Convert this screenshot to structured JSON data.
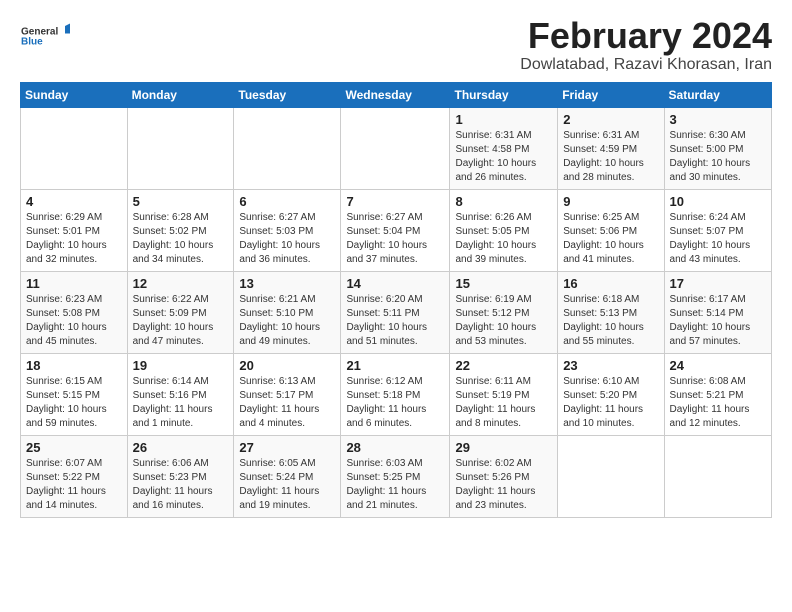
{
  "logo": {
    "general": "General",
    "blue": "Blue"
  },
  "title": "February 2024",
  "subtitle": "Dowlatabad, Razavi Khorasan, Iran",
  "weekdays": [
    "Sunday",
    "Monday",
    "Tuesday",
    "Wednesday",
    "Thursday",
    "Friday",
    "Saturday"
  ],
  "weeks": [
    [
      {
        "day": "",
        "info": ""
      },
      {
        "day": "",
        "info": ""
      },
      {
        "day": "",
        "info": ""
      },
      {
        "day": "",
        "info": ""
      },
      {
        "day": "1",
        "info": "Sunrise: 6:31 AM\nSunset: 4:58 PM\nDaylight: 10 hours and 26 minutes."
      },
      {
        "day": "2",
        "info": "Sunrise: 6:31 AM\nSunset: 4:59 PM\nDaylight: 10 hours and 28 minutes."
      },
      {
        "day": "3",
        "info": "Sunrise: 6:30 AM\nSunset: 5:00 PM\nDaylight: 10 hours and 30 minutes."
      }
    ],
    [
      {
        "day": "4",
        "info": "Sunrise: 6:29 AM\nSunset: 5:01 PM\nDaylight: 10 hours and 32 minutes."
      },
      {
        "day": "5",
        "info": "Sunrise: 6:28 AM\nSunset: 5:02 PM\nDaylight: 10 hours and 34 minutes."
      },
      {
        "day": "6",
        "info": "Sunrise: 6:27 AM\nSunset: 5:03 PM\nDaylight: 10 hours and 36 minutes."
      },
      {
        "day": "7",
        "info": "Sunrise: 6:27 AM\nSunset: 5:04 PM\nDaylight: 10 hours and 37 minutes."
      },
      {
        "day": "8",
        "info": "Sunrise: 6:26 AM\nSunset: 5:05 PM\nDaylight: 10 hours and 39 minutes."
      },
      {
        "day": "9",
        "info": "Sunrise: 6:25 AM\nSunset: 5:06 PM\nDaylight: 10 hours and 41 minutes."
      },
      {
        "day": "10",
        "info": "Sunrise: 6:24 AM\nSunset: 5:07 PM\nDaylight: 10 hours and 43 minutes."
      }
    ],
    [
      {
        "day": "11",
        "info": "Sunrise: 6:23 AM\nSunset: 5:08 PM\nDaylight: 10 hours and 45 minutes."
      },
      {
        "day": "12",
        "info": "Sunrise: 6:22 AM\nSunset: 5:09 PM\nDaylight: 10 hours and 47 minutes."
      },
      {
        "day": "13",
        "info": "Sunrise: 6:21 AM\nSunset: 5:10 PM\nDaylight: 10 hours and 49 minutes."
      },
      {
        "day": "14",
        "info": "Sunrise: 6:20 AM\nSunset: 5:11 PM\nDaylight: 10 hours and 51 minutes."
      },
      {
        "day": "15",
        "info": "Sunrise: 6:19 AM\nSunset: 5:12 PM\nDaylight: 10 hours and 53 minutes."
      },
      {
        "day": "16",
        "info": "Sunrise: 6:18 AM\nSunset: 5:13 PM\nDaylight: 10 hours and 55 minutes."
      },
      {
        "day": "17",
        "info": "Sunrise: 6:17 AM\nSunset: 5:14 PM\nDaylight: 10 hours and 57 minutes."
      }
    ],
    [
      {
        "day": "18",
        "info": "Sunrise: 6:15 AM\nSunset: 5:15 PM\nDaylight: 10 hours and 59 minutes."
      },
      {
        "day": "19",
        "info": "Sunrise: 6:14 AM\nSunset: 5:16 PM\nDaylight: 11 hours and 1 minute."
      },
      {
        "day": "20",
        "info": "Sunrise: 6:13 AM\nSunset: 5:17 PM\nDaylight: 11 hours and 4 minutes."
      },
      {
        "day": "21",
        "info": "Sunrise: 6:12 AM\nSunset: 5:18 PM\nDaylight: 11 hours and 6 minutes."
      },
      {
        "day": "22",
        "info": "Sunrise: 6:11 AM\nSunset: 5:19 PM\nDaylight: 11 hours and 8 minutes."
      },
      {
        "day": "23",
        "info": "Sunrise: 6:10 AM\nSunset: 5:20 PM\nDaylight: 11 hours and 10 minutes."
      },
      {
        "day": "24",
        "info": "Sunrise: 6:08 AM\nSunset: 5:21 PM\nDaylight: 11 hours and 12 minutes."
      }
    ],
    [
      {
        "day": "25",
        "info": "Sunrise: 6:07 AM\nSunset: 5:22 PM\nDaylight: 11 hours and 14 minutes."
      },
      {
        "day": "26",
        "info": "Sunrise: 6:06 AM\nSunset: 5:23 PM\nDaylight: 11 hours and 16 minutes."
      },
      {
        "day": "27",
        "info": "Sunrise: 6:05 AM\nSunset: 5:24 PM\nDaylight: 11 hours and 19 minutes."
      },
      {
        "day": "28",
        "info": "Sunrise: 6:03 AM\nSunset: 5:25 PM\nDaylight: 11 hours and 21 minutes."
      },
      {
        "day": "29",
        "info": "Sunrise: 6:02 AM\nSunset: 5:26 PM\nDaylight: 11 hours and 23 minutes."
      },
      {
        "day": "",
        "info": ""
      },
      {
        "day": "",
        "info": ""
      }
    ]
  ]
}
